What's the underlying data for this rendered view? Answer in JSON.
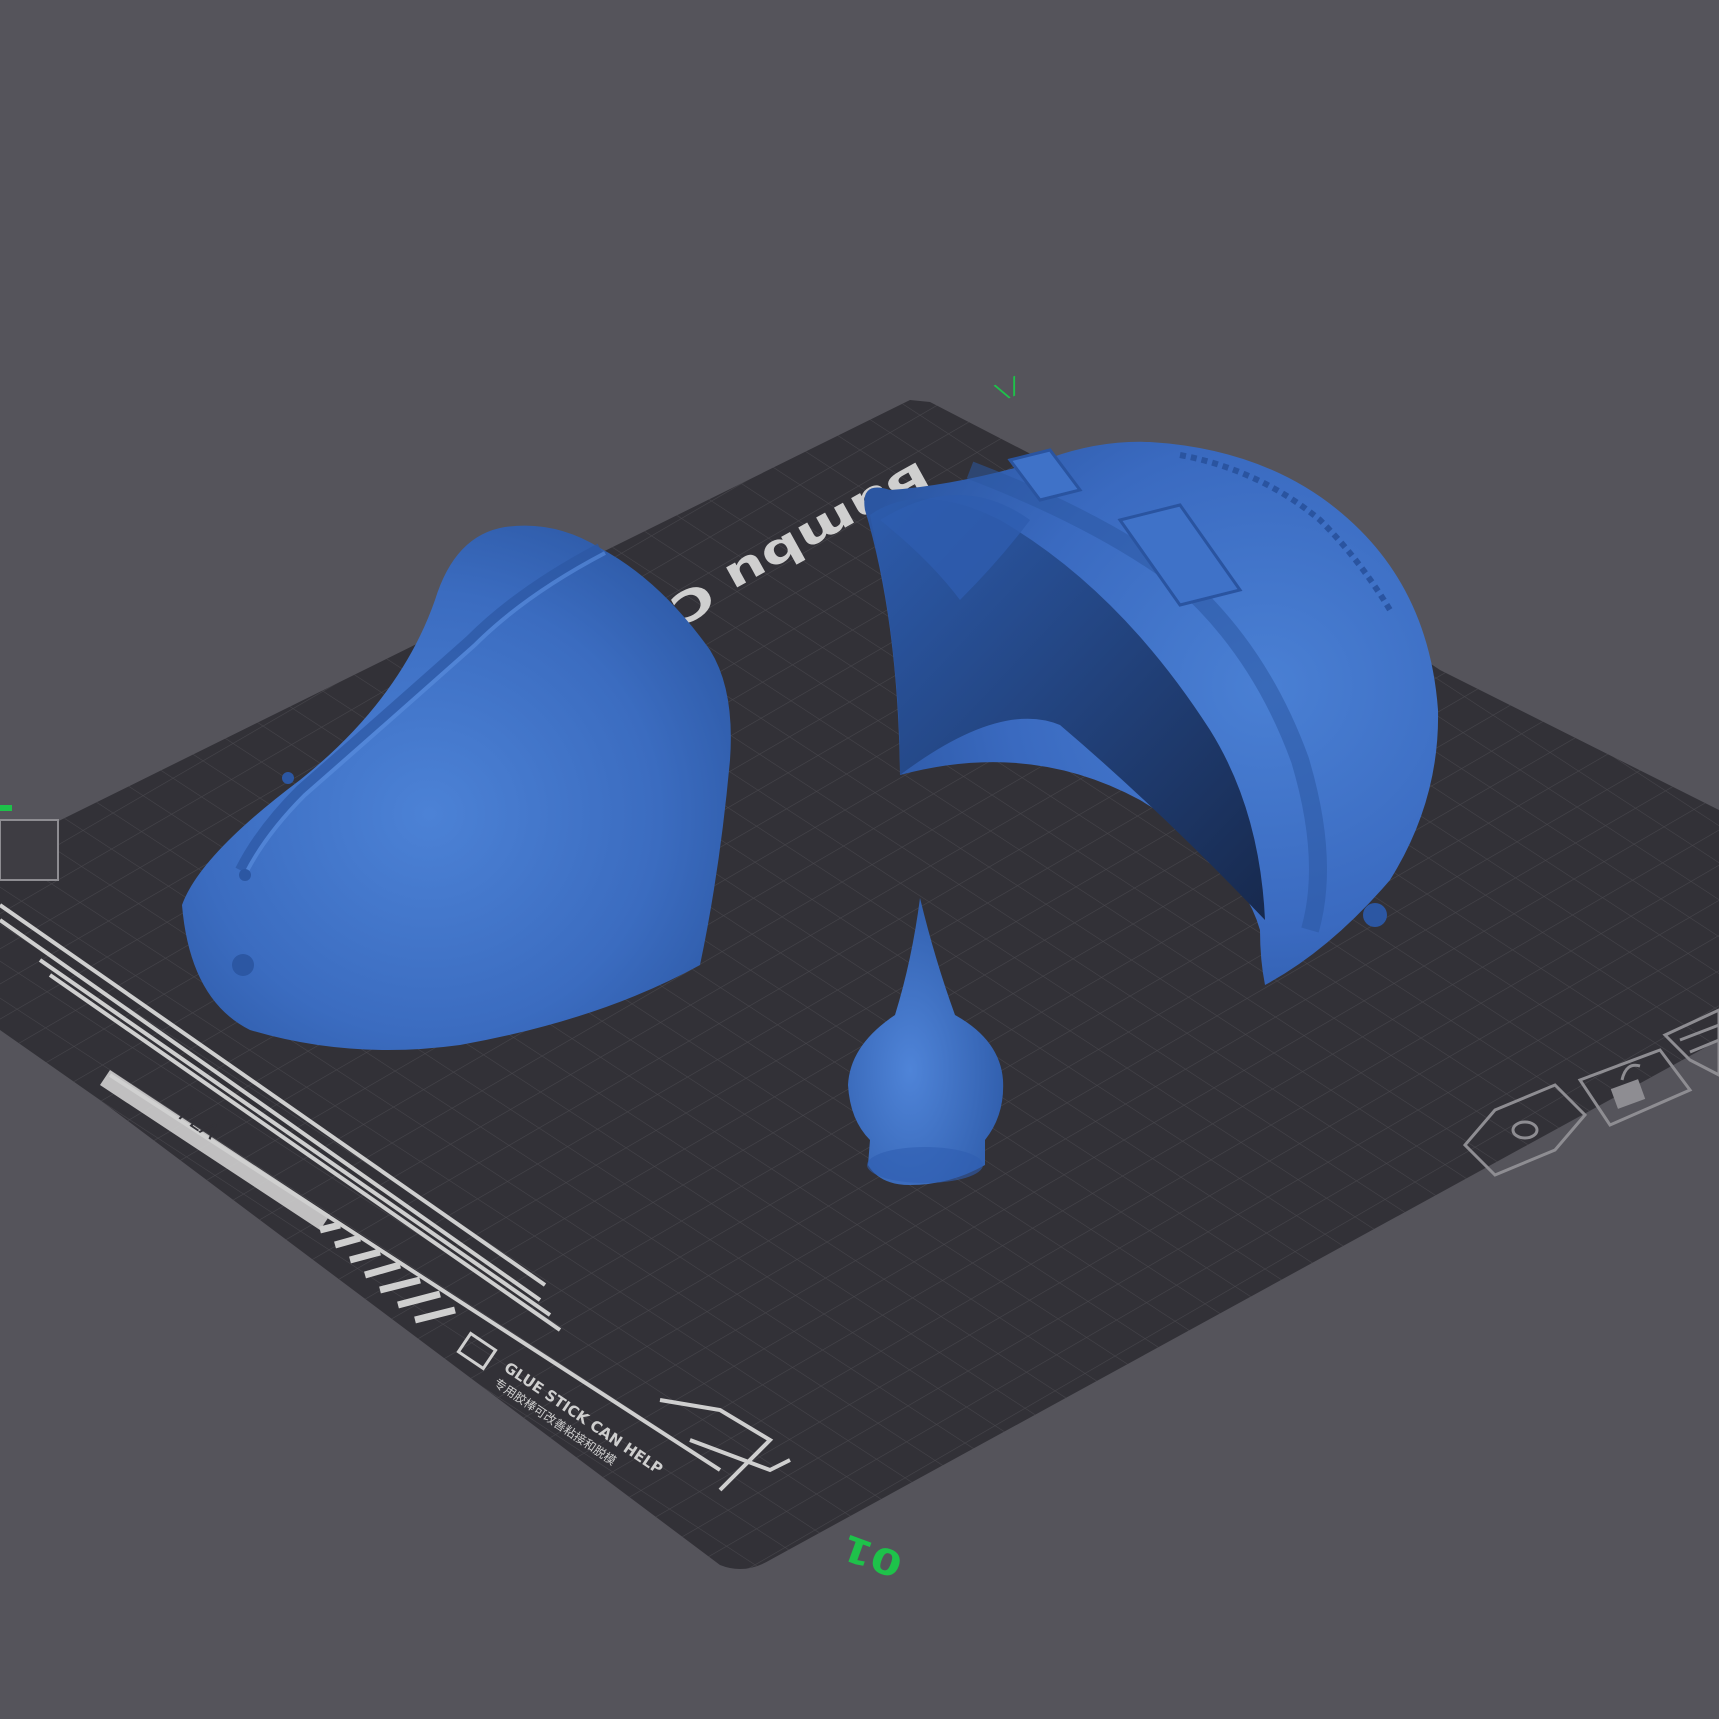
{
  "viewport": {
    "background": "#55545b",
    "plate": {
      "brand_text": "Bambu Cool",
      "plate_number": "01",
      "axis_mark_top": "\\/",
      "material_text": "PLA",
      "glue_text_en": "GLUE STICK CAN HELP",
      "glue_text_cn": "专用胶棒可改善粘接和脱模",
      "plate_color": "#323137",
      "grid_color": "#48474d",
      "accent_green": "#1ec24a",
      "marking_color": "#cfcfcf"
    },
    "objects": [
      {
        "name": "Helmet front shell",
        "color": "#3f70c7"
      },
      {
        "name": "Helmet rear shell",
        "color": "#3c6cc2"
      },
      {
        "name": "Spike finial",
        "color": "#3f6fc4"
      }
    ],
    "plate_icons": [
      "hexagon-nut-icon",
      "lock-icon",
      "grid-list-icon"
    ]
  }
}
